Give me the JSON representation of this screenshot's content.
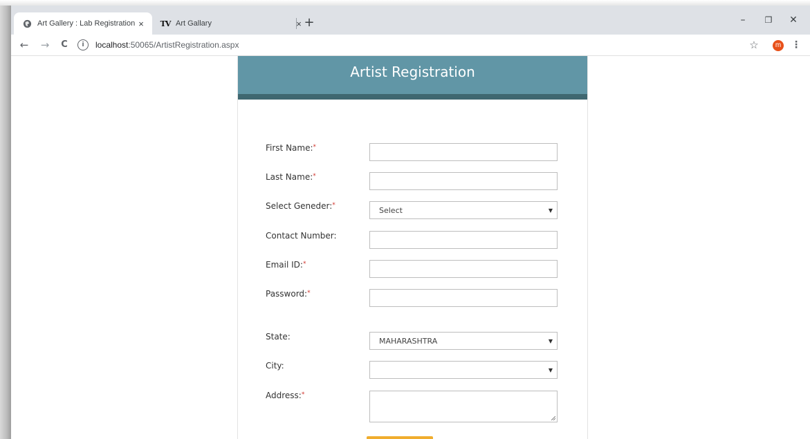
{
  "browser": {
    "tabs": [
      {
        "title": "Art Gallery : Lab Registration",
        "active": true,
        "favicon": "globe-icon"
      },
      {
        "title": "Art Gallary",
        "active": false,
        "favicon": "tv-logo-icon",
        "favicon_text": "TV"
      }
    ],
    "close_glyph": "×",
    "new_tab_glyph": "+",
    "window_controls": {
      "minimize": "–",
      "restore": "❐",
      "close": "✕"
    },
    "nav": {
      "back": "←",
      "forward": "→",
      "reload": "C"
    },
    "url": {
      "host": "localhost",
      "rest": ":50065/ArtistRegistration.aspx"
    },
    "info_glyph": "i",
    "star_glyph": "☆",
    "profile_initial": "m",
    "menu_glyph": "⋮"
  },
  "form": {
    "title": "Artist Registration",
    "required_marker": "*",
    "fields": {
      "first_name": {
        "label": "First Name:",
        "value": ""
      },
      "last_name": {
        "label": "Last Name:",
        "value": ""
      },
      "gender": {
        "label": "Select Geneder:",
        "selected": "Select"
      },
      "contact": {
        "label": "Contact Number:",
        "value": ""
      },
      "email": {
        "label": "Email ID:",
        "value": ""
      },
      "password": {
        "label": "Password:",
        "value": ""
      },
      "state": {
        "label": "State:",
        "selected": "MAHARASHTRA"
      },
      "city": {
        "label": "City:",
        "selected": ""
      },
      "address": {
        "label": "Address:",
        "value": ""
      }
    },
    "caret_glyph": "▼"
  },
  "colors": {
    "header": "#6196a6",
    "header_bar": "#3f6770",
    "required": "#d0342c",
    "button": "#f0ad2e",
    "profile": "#e8511a"
  }
}
